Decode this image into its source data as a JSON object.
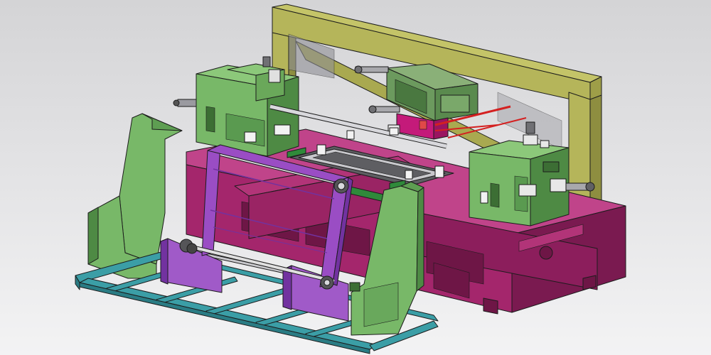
{
  "scene": {
    "description_free": true,
    "palette": {
      "background_top": "#d4d4d6",
      "background_bottom": "#f3f3f4",
      "gantry": "#b5b55a",
      "gantry_dark": "#8e8e40",
      "housing": "#78b868",
      "housing_dark": "#4e8a44",
      "bed": "#a4266c",
      "bed_dark": "#7a1a50",
      "bed_light": "#c0448a",
      "frame": "#9a4dc4",
      "frame_dark": "#7232a0",
      "base_frame": "#3b9ea6",
      "shaft": "#c8c8cc",
      "rod_red": "#d42020",
      "gray_part": "#8a8a8e"
    },
    "parts": [
      "gantry-frame",
      "left-stand-housing",
      "right-stand-housing",
      "machine-bed",
      "swing-frame",
      "side-guard-plates",
      "base-frame",
      "shafts",
      "tooling-head"
    ]
  }
}
